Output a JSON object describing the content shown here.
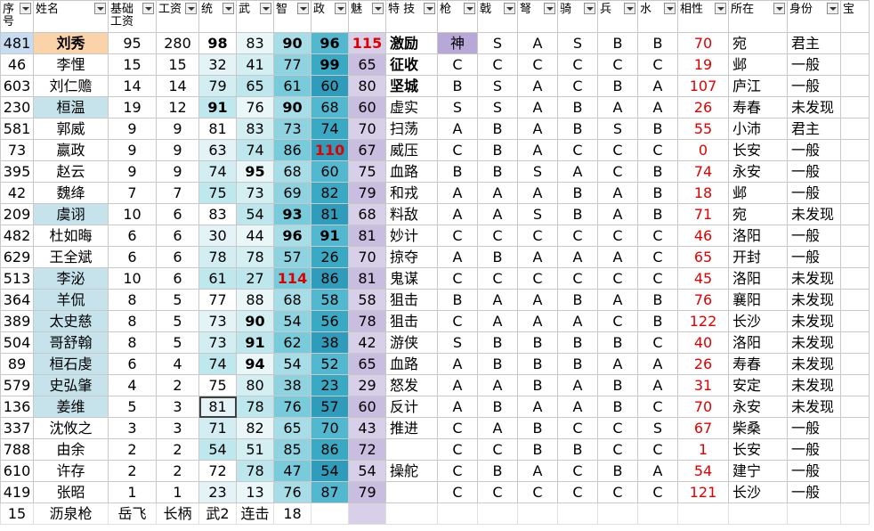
{
  "headers": [
    {
      "key": "id",
      "label": "序号",
      "filter": true
    },
    {
      "key": "name",
      "label": "姓名",
      "filter": true
    },
    {
      "key": "base",
      "label": "基础工资",
      "filter": true
    },
    {
      "key": "wage",
      "label": "工资",
      "filter": true
    },
    {
      "key": "tong",
      "label": "统",
      "filter": true
    },
    {
      "key": "wu",
      "label": "武",
      "filter": true
    },
    {
      "key": "zhi",
      "label": "智",
      "filter": true
    },
    {
      "key": "zheng",
      "label": "政",
      "filter": true
    },
    {
      "key": "mei",
      "label": "魅",
      "filter": true
    },
    {
      "key": "skill",
      "label": "特 技",
      "filter": true
    },
    {
      "key": "qiang",
      "label": "枪",
      "filter": true
    },
    {
      "key": "ji",
      "label": "戟",
      "filter": true
    },
    {
      "key": "nu",
      "label": "弩",
      "filter": true
    },
    {
      "key": "qi",
      "label": "骑",
      "filter": true
    },
    {
      "key": "bing",
      "label": "兵",
      "filter": true
    },
    {
      "key": "shui",
      "label": "水",
      "filter": true
    },
    {
      "key": "xiang",
      "label": "相性",
      "filter": true
    },
    {
      "key": "loc",
      "label": "所在",
      "filter": true
    },
    {
      "key": "status",
      "label": "身份",
      "filter": true
    },
    {
      "key": "extra",
      "label": "宝",
      "filter": false
    }
  ],
  "rows": [
    [
      "481",
      "刘秀",
      "95",
      "280",
      "98",
      "83",
      "90",
      "96",
      "115",
      "激励",
      "神",
      "S",
      "A",
      "S",
      "B",
      "B",
      "70",
      "宛",
      "君主",
      ""
    ],
    [
      "46",
      "李悝",
      "15",
      "15",
      "32",
      "41",
      "77",
      "99",
      "65",
      "征收",
      "C",
      "C",
      "C",
      "C",
      "C",
      "C",
      "19",
      "邺",
      "一般",
      ""
    ],
    [
      "603",
      "刘仁赡",
      "14",
      "14",
      "79",
      "65",
      "61",
      "60",
      "80",
      "坚城",
      "B",
      "S",
      "A",
      "C",
      "B",
      "A",
      "107",
      "庐江",
      "一般",
      ""
    ],
    [
      "230",
      "桓温",
      "19",
      "12",
      "91",
      "76",
      "90",
      "68",
      "60",
      "虚实",
      "S",
      "S",
      "A",
      "B",
      "A",
      "A",
      "26",
      "寿春",
      "未发现",
      ""
    ],
    [
      "581",
      "郭威",
      "9",
      "9",
      "81",
      "83",
      "73",
      "74",
      "70",
      "扫荡",
      "A",
      "B",
      "A",
      "B",
      "S",
      "B",
      "55",
      "小沛",
      "君主",
      ""
    ],
    [
      "73",
      "嬴政",
      "9",
      "9",
      "63",
      "74",
      "86",
      "110",
      "67",
      "威压",
      "C",
      "B",
      "A",
      "C",
      "C",
      "C",
      "0",
      "长安",
      "一般",
      ""
    ],
    [
      "395",
      "赵云",
      "9",
      "9",
      "74",
      "95",
      "68",
      "60",
      "75",
      "血路",
      "B",
      "B",
      "S",
      "A",
      "C",
      "B",
      "74",
      "永安",
      "一般",
      ""
    ],
    [
      "42",
      "魏绛",
      "7",
      "7",
      "75",
      "73",
      "69",
      "82",
      "79",
      "和戎",
      "A",
      "A",
      "A",
      "B",
      "A",
      "B",
      "18",
      "邺",
      "一般",
      ""
    ],
    [
      "209",
      "虞诩",
      "10",
      "6",
      "83",
      "54",
      "93",
      "81",
      "68",
      "料敌",
      "A",
      "A",
      "S",
      "B",
      "A",
      "B",
      "71",
      "宛",
      "未发现",
      ""
    ],
    [
      "482",
      "杜如晦",
      "6",
      "6",
      "30",
      "44",
      "96",
      "91",
      "81",
      "妙计",
      "C",
      "C",
      "C",
      "C",
      "C",
      "C",
      "46",
      "洛阳",
      "一般",
      ""
    ],
    [
      "629",
      "王全斌",
      "6",
      "6",
      "78",
      "78",
      "57",
      "26",
      "70",
      "掠夺",
      "A",
      "B",
      "A",
      "A",
      "A",
      "C",
      "65",
      "开封",
      "一般",
      ""
    ],
    [
      "513",
      "李泌",
      "10",
      "6",
      "61",
      "27",
      "114",
      "86",
      "81",
      "鬼谋",
      "C",
      "C",
      "C",
      "C",
      "C",
      "C",
      "45",
      "洛阳",
      "未发现",
      ""
    ],
    [
      "364",
      "羊侃",
      "8",
      "5",
      "77",
      "88",
      "68",
      "58",
      "58",
      "狙击",
      "B",
      "A",
      "A",
      "B",
      "A",
      "B",
      "76",
      "襄阳",
      "未发现",
      ""
    ],
    [
      "389",
      "太史慈",
      "8",
      "5",
      "73",
      "90",
      "54",
      "56",
      "78",
      "狙击",
      "C",
      "A",
      "A",
      "A",
      "C",
      "B",
      "122",
      "长沙",
      "未发现",
      ""
    ],
    [
      "504",
      "哥舒翰",
      "8",
      "5",
      "73",
      "91",
      "62",
      "38",
      "42",
      "游侠",
      "S",
      "B",
      "B",
      "B",
      "B",
      "C",
      "40",
      "洛阳",
      "未发现",
      ""
    ],
    [
      "89",
      "桓石虔",
      "6",
      "4",
      "74",
      "94",
      "54",
      "52",
      "65",
      "血路",
      "A",
      "B",
      "B",
      "B",
      "A",
      "A",
      "26",
      "寿春",
      "未发现",
      ""
    ],
    [
      "579",
      "史弘肇",
      "4",
      "2",
      "75",
      "80",
      "38",
      "23",
      "29",
      "怒发",
      "A",
      "A",
      "B",
      "A",
      "B",
      "A",
      "31",
      "安定",
      "未发现",
      ""
    ],
    [
      "136",
      "姜维",
      "5",
      "3",
      "81",
      "78",
      "76",
      "57",
      "60",
      "反计",
      "A",
      "B",
      "A",
      "A",
      "B",
      "C",
      "70",
      "永安",
      "未发现",
      ""
    ],
    [
      "337",
      "沈攸之",
      "3",
      "3",
      "71",
      "82",
      "65",
      "70",
      "43",
      "推进",
      "C",
      "A",
      "B",
      "C",
      "C",
      "S",
      "67",
      "柴桑",
      "一般",
      ""
    ],
    [
      "788",
      "由余",
      "2",
      "2",
      "54",
      "51",
      "85",
      "86",
      "72",
      "",
      "C",
      "C",
      "B",
      "B",
      "C",
      "C",
      "1",
      "长安",
      "一般",
      ""
    ],
    [
      "610",
      "许存",
      "2",
      "2",
      "72",
      "78",
      "47",
      "54",
      "54",
      "操舵",
      "C",
      "B",
      "A",
      "C",
      "B",
      "A",
      "54",
      "建宁",
      "一般",
      ""
    ],
    [
      "419",
      "张昭",
      "1",
      "1",
      "23",
      "13",
      "76",
      "87",
      "79",
      "",
      "C",
      "C",
      "C",
      "C",
      "C",
      "C",
      "121",
      "长沙",
      "一般",
      ""
    ]
  ],
  "footer": [
    "15",
    "沥泉枪",
    "岳飞",
    "长柄",
    "武2",
    "连击",
    "18"
  ],
  "bold_cells": [
    [
      0,
      1
    ],
    [
      0,
      4
    ],
    [
      0,
      6
    ],
    [
      0,
      7
    ],
    [
      0,
      9
    ],
    [
      1,
      7
    ],
    [
      1,
      9
    ],
    [
      2,
      9
    ],
    [
      3,
      4
    ],
    [
      3,
      6
    ],
    [
      6,
      5
    ],
    [
      8,
      6
    ],
    [
      9,
      6
    ],
    [
      9,
      7
    ],
    [
      13,
      5
    ],
    [
      14,
      5
    ],
    [
      15,
      5
    ]
  ],
  "red_bold_cells": [
    [
      0,
      8
    ],
    [
      5,
      7
    ],
    [
      11,
      6
    ]
  ],
  "selected_cell": [
    17,
    4
  ],
  "colors": {
    "name_orange": "#fbd3a8",
    "name_blue": "#c6e3ec",
    "id_blue": "#c6dcf0",
    "skill_lavender": "#b7a8d8",
    "xiang_red": "#e00000",
    "tong_col": [
      "#ffffff",
      "#e4f3f6",
      "#d2eef2",
      "#bfe8ee"
    ],
    "wu_col": [
      "#e9f7f8",
      "#d3eff2",
      "#bde7ed"
    ],
    "zhi_col": [
      "#a6dde6",
      "#8fd3e0",
      "#78cbda"
    ],
    "zheng_col": [
      "#52b8cf",
      "#3aa9c4",
      "#2f9cbb"
    ],
    "mei_col": [
      "#d8cfe8",
      "#c9bde0"
    ]
  },
  "blue_name_rows": [
    3,
    8,
    11,
    12,
    13,
    14,
    15,
    16,
    17
  ],
  "orange_name_rows": [
    0
  ],
  "blue_id_rows": [
    0
  ]
}
